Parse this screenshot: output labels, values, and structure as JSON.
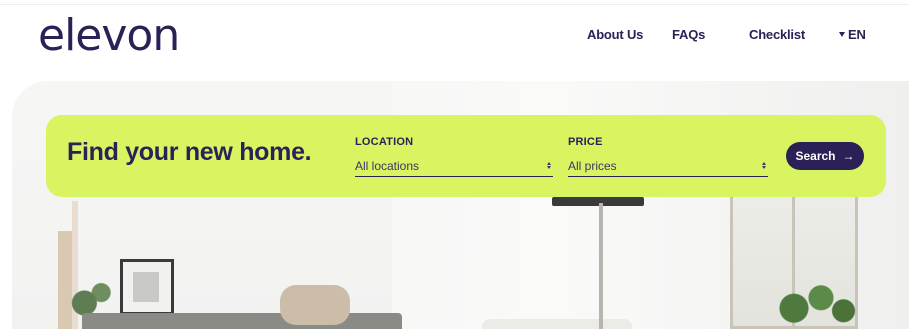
{
  "brand": {
    "logo_text": "elevon"
  },
  "nav": {
    "about_label": "About Us",
    "faqs_label": "FAQs",
    "checklist_label": "Checklist",
    "language_label": "EN"
  },
  "search": {
    "title": "Find your new home.",
    "location": {
      "label": "LOCATION",
      "value": "All locations"
    },
    "price": {
      "label": "PRICE",
      "value": "All prices"
    },
    "button_label": "Search",
    "button_icon": "arrow-right-icon"
  },
  "colors": {
    "brand": "#2b2157",
    "accent": "#d9f461"
  }
}
